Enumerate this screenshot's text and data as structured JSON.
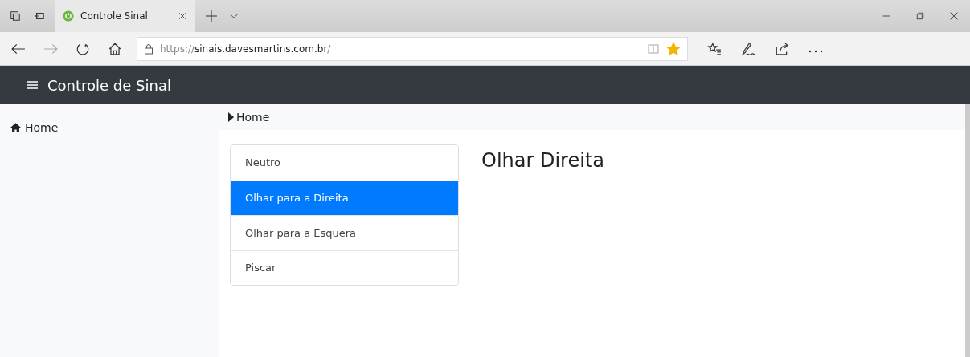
{
  "browser": {
    "tab": {
      "title": "Controle Sinal",
      "selected": true
    },
    "address": {
      "scheme": "https://",
      "host": "sinais.davesmartins.com.br",
      "path": "/"
    },
    "favorite": true
  },
  "navbar": {
    "title": "Controle de Sinal"
  },
  "sidebar": {
    "items": [
      {
        "label": "Home"
      }
    ]
  },
  "breadcrumb": [
    "Home"
  ],
  "list": [
    {
      "label": "Neutro",
      "selected": false
    },
    {
      "label": "Olhar para a Direita",
      "selected": true
    },
    {
      "label": "Olhar para a Esquera",
      "selected": false
    },
    {
      "label": "Piscar",
      "selected": false
    }
  ],
  "heading": "Olhar Direita"
}
